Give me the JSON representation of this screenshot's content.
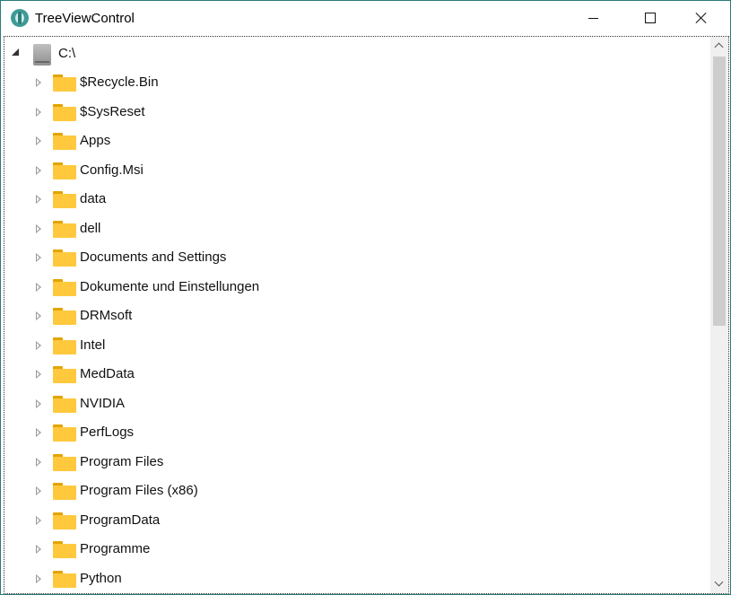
{
  "window": {
    "title": "TreeViewControl",
    "app_icon": "treeview-app-icon",
    "buttons": {
      "minimize": "minimize-icon",
      "maximize": "maximize-icon",
      "close": "close-icon"
    }
  },
  "tree": {
    "root": {
      "label": "C:\\",
      "expanded": true,
      "icon": "drive-icon"
    },
    "children": [
      {
        "label": "$Recycle.Bin"
      },
      {
        "label": "$SysReset"
      },
      {
        "label": "Apps"
      },
      {
        "label": "Config.Msi"
      },
      {
        "label": "data"
      },
      {
        "label": "dell"
      },
      {
        "label": "Documents and Settings"
      },
      {
        "label": "Dokumente und Einstellungen"
      },
      {
        "label": "DRMsoft"
      },
      {
        "label": "Intel"
      },
      {
        "label": "MedData"
      },
      {
        "label": "NVIDIA"
      },
      {
        "label": "PerfLogs"
      },
      {
        "label": "Program Files"
      },
      {
        "label": "Program Files (x86)"
      },
      {
        "label": "ProgramData"
      },
      {
        "label": "Programme"
      },
      {
        "label": "Python"
      }
    ]
  },
  "colors": {
    "window_border": "#2b7a78",
    "folder": "#ffc83d",
    "folder_tab": "#e3a400",
    "scrollbar_track": "#f0f0f0",
    "scrollbar_thumb": "#cdcdcd"
  }
}
